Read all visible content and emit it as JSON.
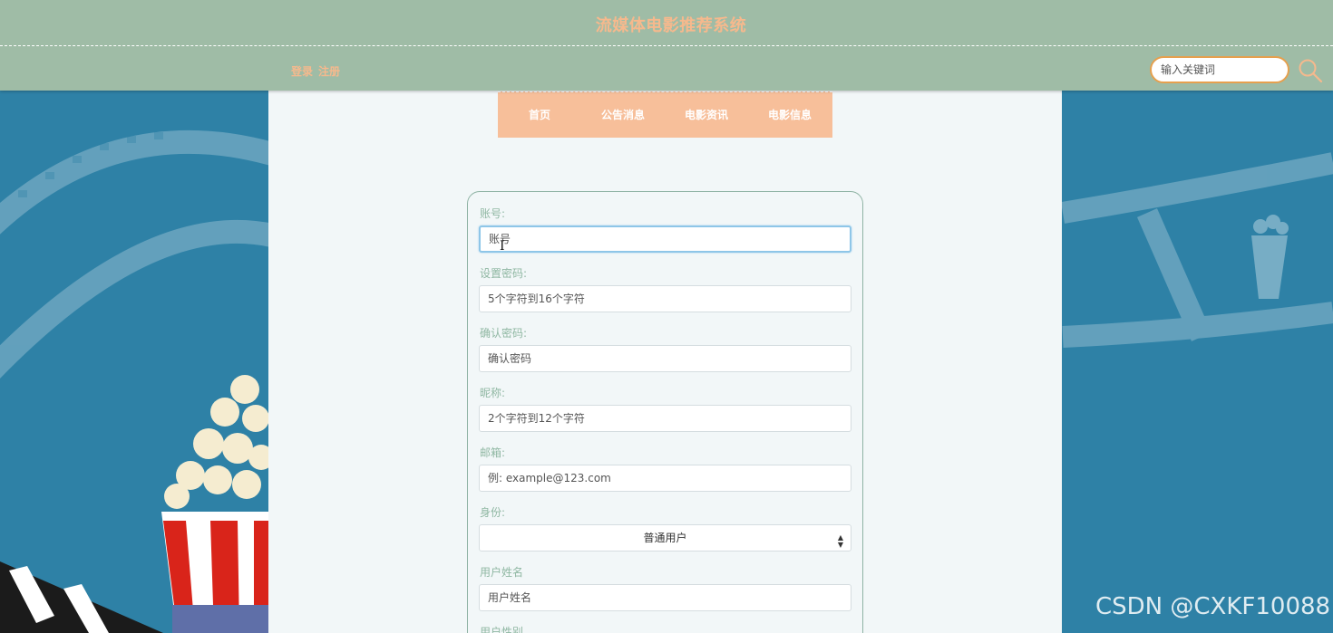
{
  "header": {
    "title": "流媒体电影推荐系统",
    "login_label": "登录",
    "register_label": "注册",
    "search_placeholder": "输入关键词"
  },
  "nav": {
    "items": [
      {
        "label": "首页"
      },
      {
        "label": "公告消息"
      },
      {
        "label": "电影资讯"
      },
      {
        "label": "电影信息"
      }
    ]
  },
  "form": {
    "fields": [
      {
        "label": "账号:",
        "placeholder": "账号"
      },
      {
        "label": "设置密码:",
        "placeholder": "5个字符到16个字符"
      },
      {
        "label": "确认密码:",
        "placeholder": "确认密码"
      },
      {
        "label": "昵称:",
        "placeholder": "2个字符到12个字符"
      },
      {
        "label": "邮箱:",
        "placeholder": "例: example@123.com"
      },
      {
        "label": "身份:",
        "value": "普通用户"
      },
      {
        "label": "用户姓名",
        "placeholder": "用户姓名"
      },
      {
        "label": "用户性别"
      }
    ]
  },
  "watermark": "CSDN @CXKF10088",
  "colors": {
    "header_bg": "#9fbca6",
    "accent_peach": "#f7bf9a",
    "title_text": "#f6b98d",
    "page_bg": "#2e81a6",
    "panel_bg": "#f2f7f8",
    "search_border": "#e6a04e"
  }
}
